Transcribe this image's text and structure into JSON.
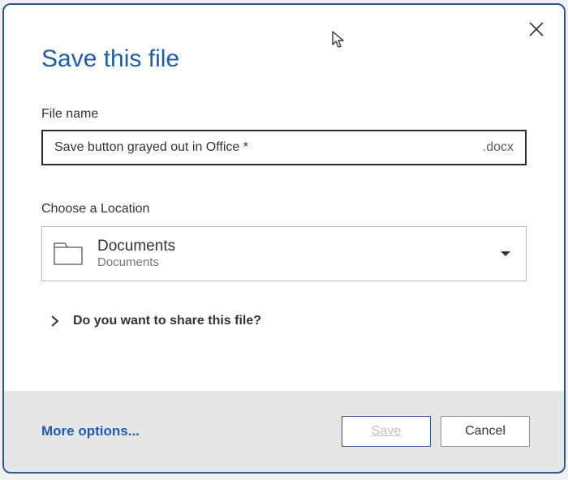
{
  "title": "Save this file",
  "filename": {
    "label": "File name",
    "value": "Save button grayed out in Office *",
    "extension": ".docx"
  },
  "location": {
    "label": "Choose a Location",
    "primary": "Documents",
    "secondary": "Documents"
  },
  "share": {
    "text": "Do you want to share this file?"
  },
  "footer": {
    "more_options": "More options...",
    "save": "Save",
    "cancel": "Cancel"
  }
}
